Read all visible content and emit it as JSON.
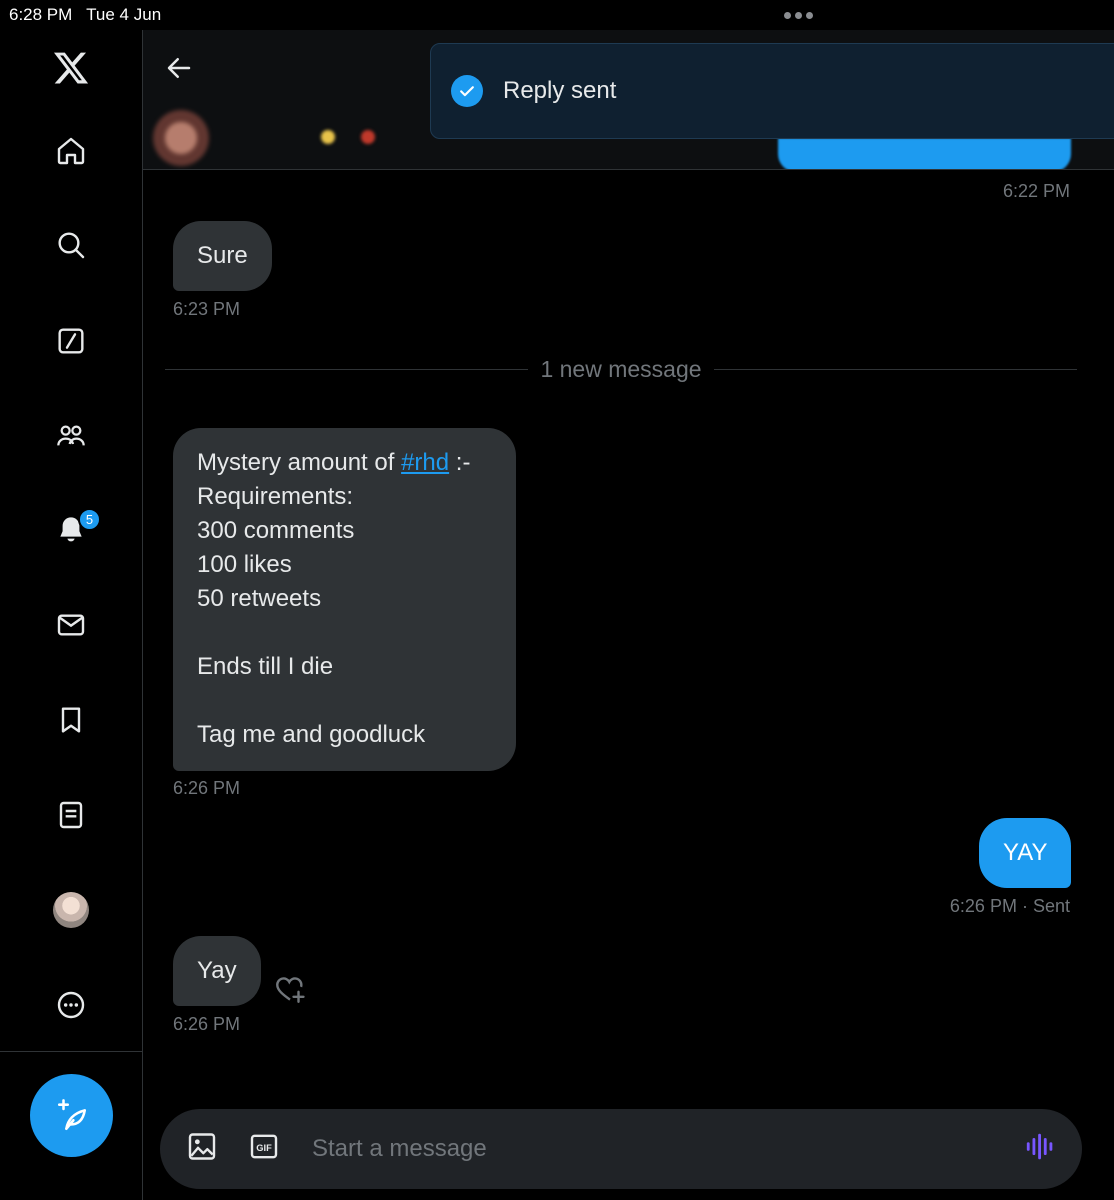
{
  "status_bar": {
    "time_date": "6:28 PM   Tue 4 Jun"
  },
  "sidebar": {
    "notifications_badge": "5",
    "items": [
      "x-logo",
      "home-icon",
      "search-icon",
      "grok-icon",
      "communities-icon",
      "notifications-icon",
      "messages-icon",
      "bookmarks-icon",
      "lists-icon",
      "profile-avatar",
      "more-icon"
    ]
  },
  "toast": {
    "message": "Reply sent"
  },
  "conversation": {
    "top_timestamp": "6:22 PM",
    "messages": [
      {
        "direction": "in",
        "text": "Sure",
        "time": "6:23 PM"
      },
      {
        "direction": "in",
        "lines": [
          "Mystery amount of ",
          "#rhd",
          " :-",
          "Requirements:",
          "300 comments",
          "100 likes",
          "50 retweets",
          "",
          "Ends till I die",
          "",
          "Tag me and goodluck"
        ],
        "time": "6:26 PM"
      },
      {
        "direction": "out",
        "text": "YAY",
        "time": "6:26 PM",
        "status": "· Sent"
      },
      {
        "direction": "in",
        "text": "Yay",
        "time": "6:26 PM"
      }
    ],
    "new_message_divider": "1 new message"
  },
  "composer": {
    "placeholder": "Start a message"
  },
  "colors": {
    "accent": "#1d9bf0",
    "bubble_in": "#2f3336",
    "background": "#000000",
    "voice": "#7856ff"
  }
}
